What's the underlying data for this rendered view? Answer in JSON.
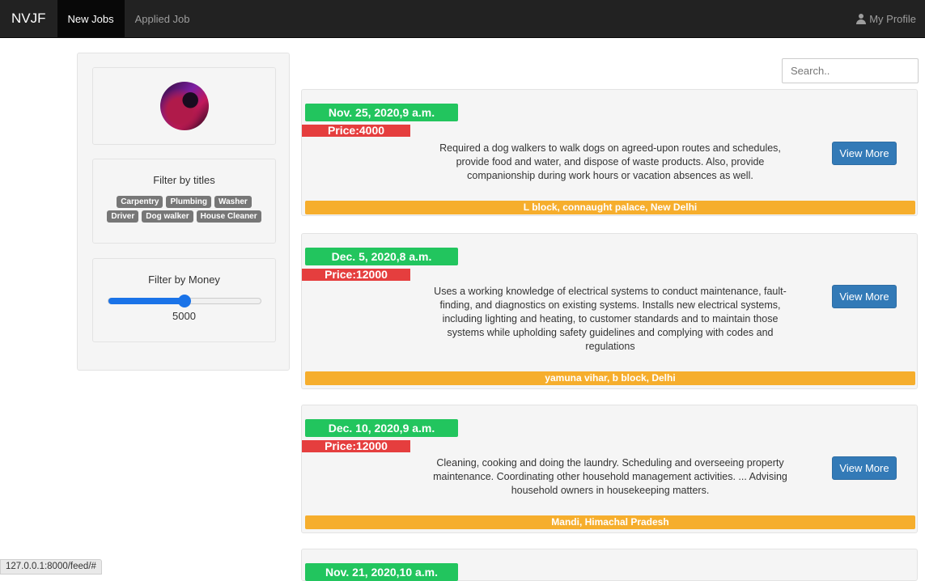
{
  "navbar": {
    "brand": "NVJF",
    "items": [
      {
        "label": "New Jobs",
        "active": true
      },
      {
        "label": "Applied Job",
        "active": false
      }
    ],
    "profile_label": "My Profile"
  },
  "sidebar": {
    "filter_titles": {
      "heading": "Filter by titles",
      "tags": [
        "Carpentry",
        "Plumbing",
        "Washer",
        "Driver",
        "Dog walker",
        "House Cleaner"
      ]
    },
    "filter_money": {
      "heading": "Filter by Money",
      "value": "5000",
      "slider_fraction": 0.5
    }
  },
  "search": {
    "placeholder": "Search.."
  },
  "jobs": [
    {
      "date": "Nov. 25, 2020,9 a.m.",
      "price": "Price:4000",
      "description": "Required a dog walkers to walk dogs on agreed-upon routes and schedules, provide food and water, and dispose of waste products. Also, provide companionship during work hours or vacation absences as well.",
      "button": "View More",
      "location": "L block, connaught palace, New Delhi"
    },
    {
      "date": "Dec. 5, 2020,8 a.m.",
      "price": "Price:12000",
      "description": "Uses a working knowledge of electrical systems to conduct maintenance, fault-finding, and diagnostics on existing systems. Installs new electrical systems, including lighting and heating, to customer standards and to maintain those systems while upholding safety guidelines and complying with codes and regulations",
      "button": "View More",
      "location": "yamuna vihar, b block, Delhi"
    },
    {
      "date": "Dec. 10, 2020,9 a.m.",
      "price": "Price:12000",
      "description": "Cleaning, cooking and doing the laundry. Scheduling and overseeing property maintenance. Coordinating other household management activities. ... Advising household owners in housekeeping matters.",
      "button": "View More",
      "location": "Mandi, Himachal Pradesh"
    },
    {
      "date": "Nov. 21, 2020,10 a.m."
    }
  ],
  "statusbar": {
    "url": "127.0.0.1:8000/feed/#"
  }
}
